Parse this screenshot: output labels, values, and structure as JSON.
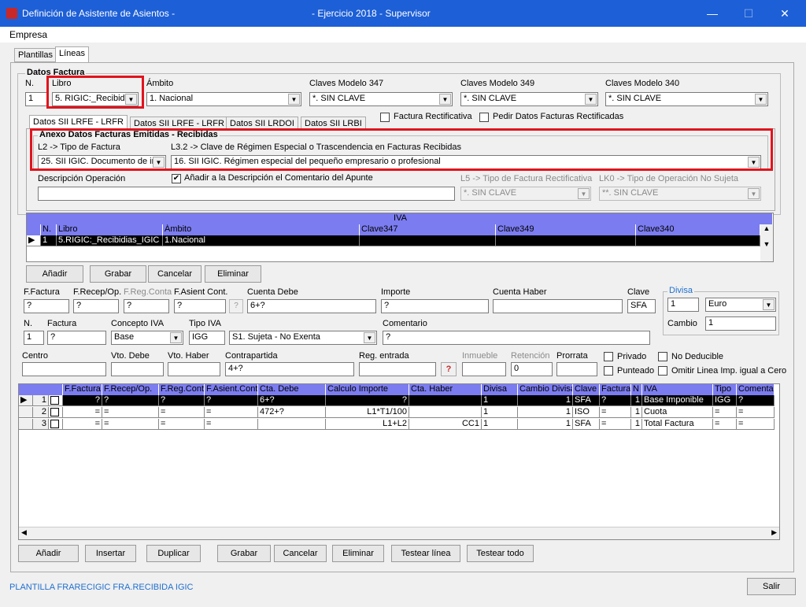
{
  "window": {
    "title": "Definición de Asistente de Asientos -",
    "center_title": "- Ejercicio 2018 - Supervisor",
    "minimize": "—",
    "maximize": "☐",
    "close": "✕"
  },
  "menu": {
    "empresa": "Empresa"
  },
  "tabs": {
    "plantillas": "Plantillas",
    "lineas": "Líneas"
  },
  "datos_factura": {
    "title": "Datos Factura",
    "n_label": "N.",
    "n_value": "1",
    "libro_label": "Libro",
    "libro_value": "5. RIGIC:_Recibidi",
    "ambito_label": "Ámbito",
    "ambito_value": "1. Nacional",
    "c347_label": "Claves Modelo 347",
    "c347_value": "*. SIN CLAVE",
    "c349_label": "Claves Modelo 349",
    "c349_value": "*. SIN CLAVE",
    "c340_label": "Claves Modelo 340",
    "c340_value": "*. SIN CLAVE",
    "rect_label": "Factura Rectificativa",
    "pedir_label": "Pedir Datos Facturas Rectificadas"
  },
  "sii_tabs": [
    "Datos SII LRFE - LRFR",
    "Datos SII LRFE - LRFR",
    "Datos SII LRDOI",
    "Datos SII LRBI"
  ],
  "anexo": {
    "title": "Anexo Datos Facturas Emitidas - Recibidas",
    "tipo_label": "L2 -> Tipo de Factura",
    "tipo_value": "25. SII IGIC. Documento de ir",
    "clave_label": "L3.2 -> Clave de Régimen Especial o Trascendencia en Facturas Recibidas",
    "clave_value": "16. SII IGIC. Régimen especial del pequeño empresario o profesional",
    "desc_label": "Descripción Operación",
    "anadir_label": "Añadir a la Descripción el Comentario del Apunte",
    "l5_label": "L5 -> Tipo de Factura Rectificativa",
    "l5_value": "*. SIN CLAVE",
    "lk0_label": "LK0 -> Tipo de Operación No Sujeta",
    "lk0_value": "**. SIN CLAVE"
  },
  "iva_grid": {
    "title": "IVA",
    "headers": [
      "N.",
      "Libro",
      "Ámbito",
      "Clave347",
      "Clave349",
      "Clave340"
    ],
    "row": [
      "1",
      "5.RIGIC:_Recibidias_IGIC",
      "1.Nacional",
      "",
      "",
      ""
    ]
  },
  "grid_buttons": {
    "anadir": "Añadir",
    "grabar": "Grabar",
    "cancelar": "Cancelar",
    "eliminar": "Eliminar"
  },
  "form": {
    "ffactura_label": "F.Factura",
    "ffactura_value": "?",
    "frecep_label": "F.Recep/Op.",
    "frecep_value": "?",
    "fregconta_label": "F.Reg.Conta",
    "fregconta_value": "?",
    "fasient_label": "F.Asient Cont.",
    "fasient_value": "?",
    "ctadebe_label": "Cuenta Debe",
    "ctadebe_value": "6+?",
    "importe_label": "Importe",
    "importe_value": "?",
    "ctahaber_label": "Cuenta Haber",
    "ctahaber_value": "",
    "clave_label": "Clave",
    "clave_value": "SFA",
    "divisa_label": "Divisa",
    "divisa_n": "1",
    "divisa_value": "Euro",
    "cambio_label": "Cambio",
    "cambio_value": "1",
    "n_label": "N.",
    "n_value": "1",
    "factura_label": "Factura",
    "factura_value": "?",
    "concepto_label": "Concepto IVA",
    "concepto_value": "Base",
    "tipoiva_label": "Tipo IVA",
    "tipoiva_code": "IGG",
    "tipoiva_value": "S1. Sujeta - No Exenta",
    "comentario_label": "Comentario",
    "comentario_value": "?",
    "centro_label": "Centro",
    "centro_value": "",
    "vtodebe_label": "Vto. Debe",
    "vtodebe_value": "",
    "vtohaber_label": "Vto. Haber",
    "vtohaber_value": "",
    "contrapartida_label": "Contrapartida",
    "contrapartida_value": "4+?",
    "regentrada_label": "Reg. entrada",
    "regentrada_value": "",
    "inmueble_label": "Inmueble",
    "inmueble_value": "",
    "retencion_label": "Retención",
    "retencion_value": "0",
    "prorrata_label": "Prorrata",
    "prorrata_value": "",
    "privado_label": "Privado",
    "nodeducible_label": "No Deducible",
    "punteado_label": "Punteado",
    "omitir_label": "Omitir Linea Imp. igual a Cero"
  },
  "lines_grid": {
    "headers": [
      "F.Factura",
      "F.Recep/Op.",
      "F.Reg.Conta",
      "F.Asient.Cont",
      "Cta. Debe",
      "Calculo Importe",
      "Cta. Haber",
      "Divisa",
      "Cambio Divisa",
      "Clave",
      "Factura",
      "N",
      "IVA",
      "Tipo",
      "Comentar"
    ],
    "rows": [
      {
        "n": "1",
        "cells": [
          "?",
          "?",
          "?",
          "?",
          "6+?",
          "?",
          "",
          "1",
          "1",
          "SFA",
          "?",
          "1",
          "Base Imponible",
          "IGG",
          "?"
        ]
      },
      {
        "n": "2",
        "cells": [
          "=",
          "=",
          "=",
          "=",
          "472+?",
          "L1*T1/100",
          "",
          "1",
          "1",
          "ISO",
          "=",
          "1",
          "Cuota",
          "=",
          "="
        ]
      },
      {
        "n": "3",
        "cells": [
          "=",
          "=",
          "=",
          "=",
          "",
          "L1+L2",
          "CC1",
          "1",
          "1",
          "SFA",
          "=",
          "1",
          "Total Factura",
          "=",
          "="
        ]
      }
    ]
  },
  "bottom_buttons": {
    "anadir": "Añadir",
    "insertar": "Insertar",
    "duplicar": "Duplicar",
    "grabar": "Grabar",
    "cancelar": "Cancelar",
    "eliminar": "Eliminar",
    "testear_linea": "Testear línea",
    "testear_todo": "Testear todo"
  },
  "status": {
    "text": "PLANTILLA FRARECIGIC FRA.RECIBIDA IGIC",
    "salir": "Salir"
  }
}
